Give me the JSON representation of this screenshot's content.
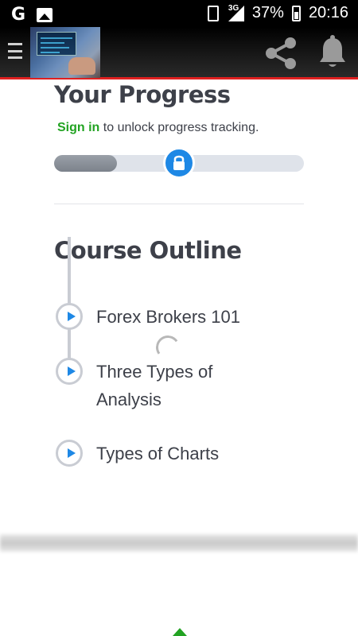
{
  "status_bar": {
    "time": "20:16",
    "battery": "37%",
    "network": "3G",
    "icons": [
      "google-icon",
      "image-icon",
      "vibrate-icon",
      "signal-icon",
      "battery-icon"
    ]
  },
  "app_bar": {
    "menu_icon": "hamburger-icon",
    "thumbnail": "course-thumbnail",
    "share_icon": "share-icon",
    "notification_icon": "bell-icon",
    "accent_color": "#e02020"
  },
  "progress": {
    "title": "Your Progress",
    "sign_in_link": "Sign in",
    "sign_in_suffix": " to unlock progress tracking.",
    "value": 0.25,
    "lock_icon": "lock-icon"
  },
  "outline": {
    "title": "Course Outline",
    "lessons": [
      {
        "label": "Forex Brokers 101"
      },
      {
        "label": "Three Types of Analysis"
      },
      {
        "label": "Types of Charts"
      }
    ],
    "play_icon": "play-icon"
  },
  "colors": {
    "link_green": "#22a322",
    "accent_blue": "#1e88e5",
    "text_dark": "#3d4049"
  }
}
